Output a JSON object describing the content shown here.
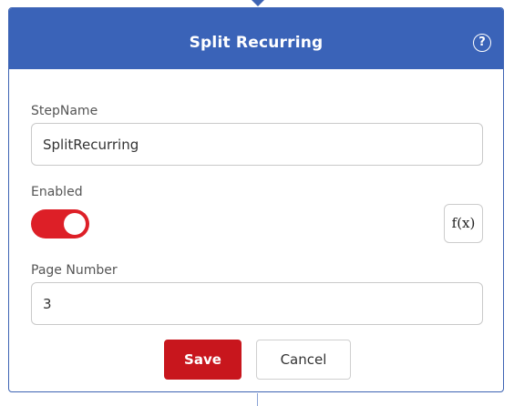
{
  "dialog": {
    "title": "Split Recurring",
    "help_icon": "question-circle-icon",
    "help_glyph": "?"
  },
  "fields": {
    "step_name": {
      "label": "StepName",
      "value": "SplitRecurring"
    },
    "enabled": {
      "label": "Enabled",
      "on": true,
      "fx_icon": "function-icon",
      "fx_glyph": "f(x)"
    },
    "page_number": {
      "label": "Page Number",
      "value": "3"
    }
  },
  "actions": {
    "save_label": "Save",
    "cancel_label": "Cancel"
  },
  "colors": {
    "header_bg": "#3a63b8",
    "toggle_on": "#dd1f27",
    "save_bg": "#c8161d"
  }
}
